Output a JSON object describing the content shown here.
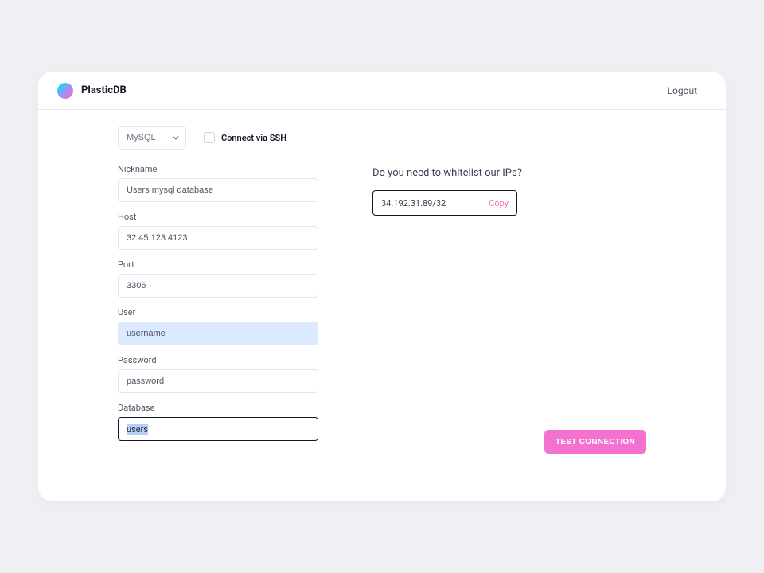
{
  "brand": {
    "name": "PlasticDB"
  },
  "topbar": {
    "logout": "Logout"
  },
  "dbtype": {
    "selected": "MySQL",
    "options_visible": "MySQL"
  },
  "ssh": {
    "label": "Connect via SSH"
  },
  "fields": {
    "nickname": {
      "label": "Nickname",
      "value": "Users mysql database"
    },
    "host": {
      "label": "Host",
      "value": "32.45.123.4123"
    },
    "port": {
      "label": "Port",
      "value": "3306"
    },
    "user": {
      "label": "User",
      "value": "username"
    },
    "password": {
      "label": "Password",
      "value": "password"
    },
    "database": {
      "label": "Database",
      "value": "users"
    }
  },
  "whitelist": {
    "title": "Do you need to whitelist our IPs?",
    "ip": "34.192.31.89/32",
    "copy_label": "Copy"
  },
  "actions": {
    "test_connection": "TEST CONNECTION"
  }
}
